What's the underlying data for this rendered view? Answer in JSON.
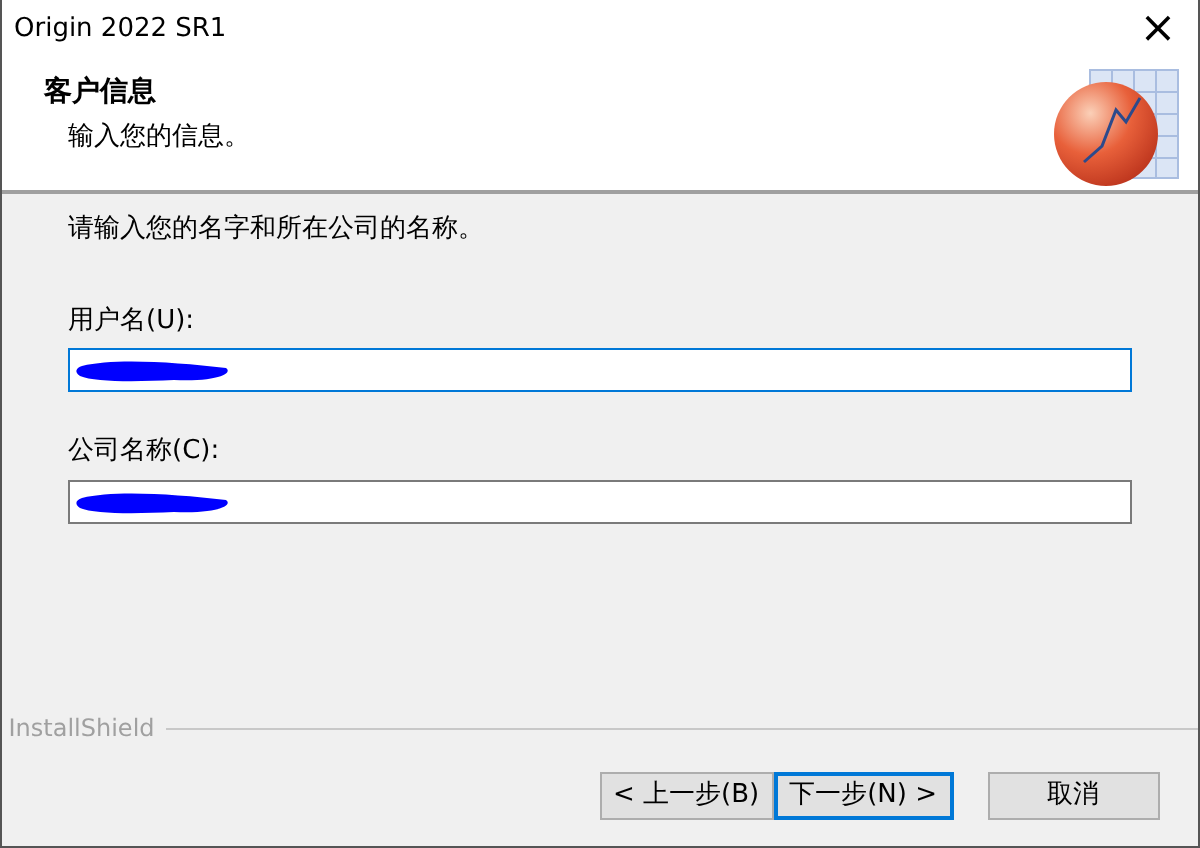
{
  "window": {
    "title": "Origin 2022 SR1",
    "close": "×"
  },
  "header": {
    "title": "客户信息",
    "subtitle": "输入您的信息。"
  },
  "instruction": "请输入您的名字和所在公司的名称。",
  "fields": [
    {
      "label": "用户名(U):",
      "focused": true,
      "redacted": true
    },
    {
      "label": "公司名称(C):",
      "focused": false,
      "redacted": true
    }
  ],
  "brand": "InstallShield",
  "buttons": [
    {
      "label": "< 上一步(B)",
      "default": false
    },
    {
      "label": "下一步(N) >",
      "default": true
    },
    {
      "label": "取消",
      "default": false
    }
  ]
}
